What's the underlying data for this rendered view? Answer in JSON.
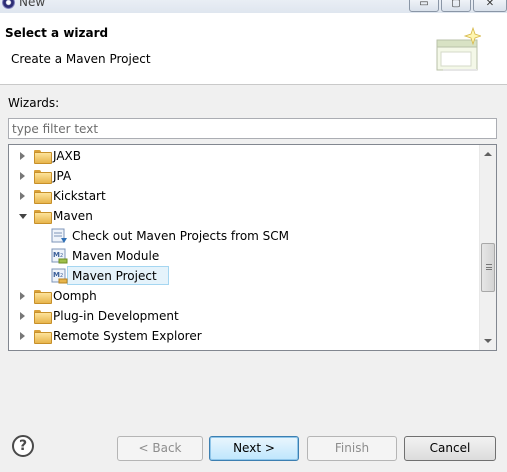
{
  "window": {
    "title": "New",
    "minimize_glyph": "▭",
    "maximize_glyph": "▢",
    "close_glyph": "✕"
  },
  "header": {
    "title": "Select a wizard",
    "description": "Create a Maven Project",
    "graphic_icon": "wizard-banner-icon"
  },
  "wizards": {
    "label": "Wizards:",
    "filter_placeholder": "type filter text",
    "filter_value": "",
    "tree": [
      {
        "label": "JAXB",
        "type": "folder",
        "expanded": false
      },
      {
        "label": "JPA",
        "type": "folder",
        "expanded": false
      },
      {
        "label": "Kickstart",
        "type": "folder",
        "expanded": false
      },
      {
        "label": "Maven",
        "type": "folder",
        "expanded": true
      },
      {
        "label": "Check out Maven Projects from SCM",
        "type": "item",
        "icon": "maven-checkout-icon"
      },
      {
        "label": "Maven Module",
        "type": "item",
        "icon": "maven-module-icon"
      },
      {
        "label": "Maven Project",
        "type": "item",
        "icon": "maven-project-icon",
        "selected": true
      },
      {
        "label": "Oomph",
        "type": "folder",
        "expanded": false
      },
      {
        "label": "Plug-in Development",
        "type": "folder",
        "expanded": false
      },
      {
        "label": "Remote System Explorer",
        "type": "folder",
        "expanded": false
      }
    ]
  },
  "footer": {
    "help_glyph": "?",
    "back_label": "< Back",
    "next_label": "Next >",
    "finish_label": "Finish",
    "cancel_label": "Cancel"
  },
  "colors": {
    "selection_bg": "#e5f3fb",
    "selection_border": "#a5d6f1",
    "folder": "#e7b54c",
    "primary_button_border": "#3c7fb1"
  }
}
